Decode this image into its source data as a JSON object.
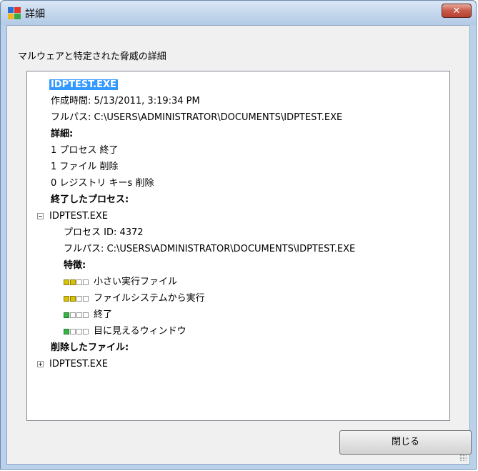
{
  "window": {
    "title": "詳細",
    "close_glyph": "✕",
    "colors": {
      "title_gradient_top": "#dbe7f5",
      "close_red": "#c75a49",
      "selection": "#3399ff"
    }
  },
  "subtitle": "マルウェアと特定された脅威の詳細",
  "details": {
    "file_name": "IDPTEST.EXE",
    "created_label": "作成時間: 5/13/2011, 3:19:34 PM",
    "fullpath_label": "フルパス: C:\\USERS\\ADMINISTRATOR\\DOCUMENTS\\IDPTEST.EXE",
    "details_heading": "詳細:",
    "summary": [
      "1 プロセス 終了",
      "1 ファイル 削除",
      "0 レジストリ キーs 削除"
    ],
    "terminated_heading": "終了したプロセス:",
    "process": {
      "toggle": "collapse",
      "name": "IDPTEST.EXE",
      "pid_label": "プロセス ID: 4372",
      "fullpath_label": "フルパス: C:\\USERS\\ADMINISTRATOR\\DOCUMENTS\\IDPTEST.EXE",
      "traits_heading": "特徴:",
      "traits": [
        {
          "label": "小さい実行ファイル",
          "level": 2,
          "color": "yellow"
        },
        {
          "label": "ファイルシステムから実行",
          "level": 2,
          "color": "yellow"
        },
        {
          "label": "終了",
          "level": 1,
          "color": "green"
        },
        {
          "label": "目に見えるウィンドウ",
          "level": 1,
          "color": "green"
        }
      ]
    },
    "deleted_heading": "削除したファイル:",
    "deleted_file": {
      "toggle": "expand",
      "name": "IDPTEST.EXE"
    }
  },
  "buttons": {
    "close_label": "閉じる"
  }
}
